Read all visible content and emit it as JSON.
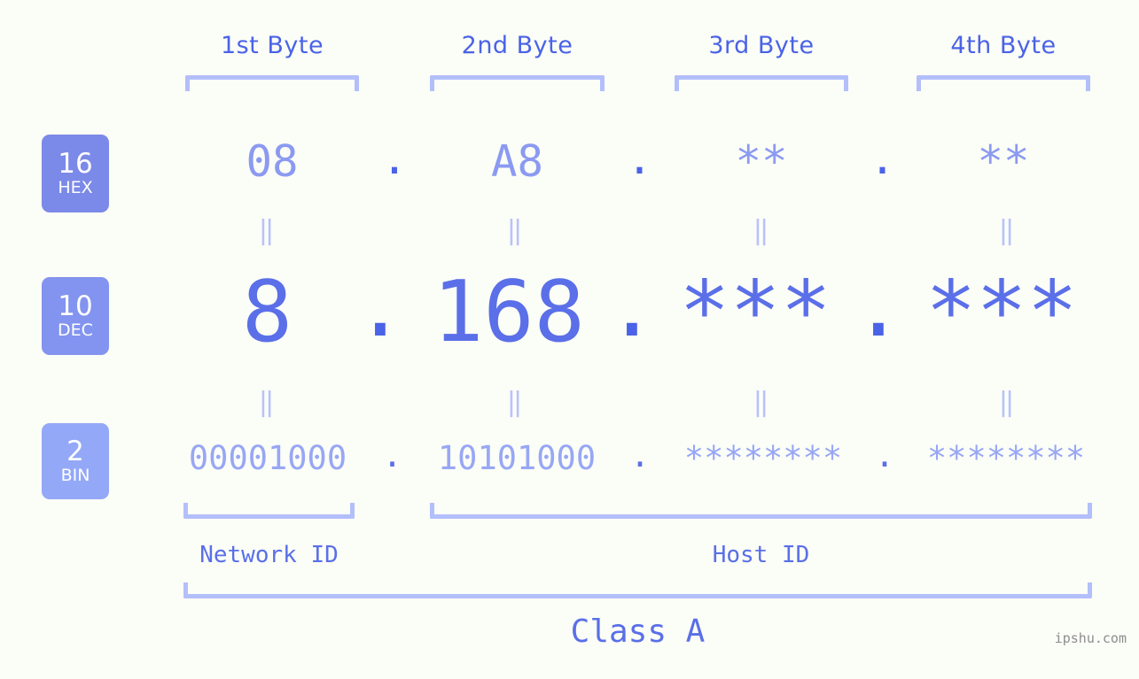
{
  "page": {
    "background": "#fbfdf7",
    "watermark": "ipshu.com"
  },
  "colors": {
    "accent": "#4a63e7",
    "dec_value": "#5a6fe8",
    "hex_value": "#8b9af0",
    "bin_value": "#98a7f4",
    "bracket": "#b3bffb",
    "equals": "#b8c2fb",
    "badge_hex": "#7b89e8",
    "badge_dec": "#8294ef",
    "badge_bin": "#93a8f7"
  },
  "byte_headers": [
    {
      "label": "1st Byte"
    },
    {
      "label": "2nd Byte"
    },
    {
      "label": "3rd Byte"
    },
    {
      "label": "4th Byte"
    }
  ],
  "bases": [
    {
      "number": "16",
      "name": "HEX"
    },
    {
      "number": "10",
      "name": "DEC"
    },
    {
      "number": "2",
      "name": "BIN"
    }
  ],
  "rows": {
    "hex": {
      "values": [
        "08",
        "A8",
        "**",
        "**"
      ],
      "separators": [
        ".",
        ".",
        "."
      ]
    },
    "dec": {
      "values": [
        "8",
        "168",
        "***",
        "***"
      ],
      "separators": [
        ".",
        ".",
        "."
      ]
    },
    "bin": {
      "values": [
        "00001000",
        "10101000",
        "********",
        "********"
      ],
      "separators": [
        ".",
        ".",
        "."
      ]
    }
  },
  "equals_marks": {
    "symbol": "‖",
    "hex_to_dec": [
      "‖",
      "‖",
      "‖",
      "‖"
    ],
    "dec_to_bin": [
      "‖",
      "‖",
      "‖",
      "‖"
    ]
  },
  "segments": {
    "network_id": "Network ID",
    "host_id": "Host ID",
    "class": "Class A"
  }
}
